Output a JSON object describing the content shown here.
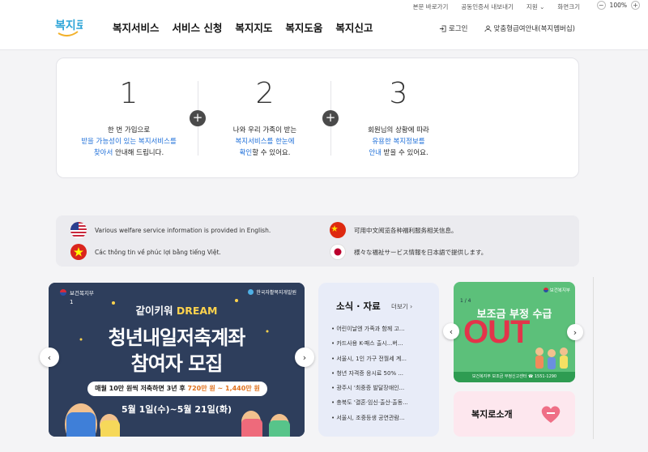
{
  "header": {
    "logo_text": "복지로",
    "utility": [
      "본문 바로가기",
      "공동인증서 내보내기",
      "지원",
      "화면크기"
    ],
    "zoom": {
      "minus": "−",
      "value": "100%",
      "plus": "+"
    },
    "nav": [
      "복지서비스",
      "서비스 신청",
      "복지지도",
      "복지도움",
      "복지신고"
    ],
    "login": "로그인",
    "mypage": "맞춤형급여안내(복지멤버십)"
  },
  "steps": [
    {
      "num": "1",
      "line1": "한 번 가입으로",
      "line2_blue": "받을 가능성이 있는 복지서비스를",
      "line3_blue": "찾아서",
      "line3_rest": " 안내해 드립니다."
    },
    {
      "num": "2",
      "line1": "나와 우리 가족이 받는",
      "line2_blue": "복지서비스를 한눈에",
      "line3_blue": "확인",
      "line3_rest": "할 수 있어요."
    },
    {
      "num": "3",
      "line1": "회원님의 상황에 따라",
      "line2_blue": "유용한 복지정보를",
      "line3_blue": "안내",
      "line3_rest": " 받을 수 있어요."
    }
  ],
  "plus_symbol": "+",
  "languages": [
    {
      "flag": "us-flag-icon",
      "text": "Various welfare service information is provided in English."
    },
    {
      "flag": "china-flag-icon",
      "text": "可用中文阅览各种福利服务相关信息。"
    },
    {
      "flag": "vietnam-flag-icon",
      "text": "Các thông tin về phúc lợi bằng tiếng Việt."
    },
    {
      "flag": "japan-flag-icon",
      "text": "様々な福祉サービス情報を日本語で提供します。"
    }
  ],
  "banner": {
    "ministry": "보건복지부",
    "institute": "한국자활복지개발원",
    "counter": "1",
    "together_prefix": "같이키워 ",
    "together_highlight": "DREAM",
    "title1": "청년내일저축계좌",
    "title2": "참여자 모집",
    "pill_a": "매월 10만 원씩 저축하면 3년 후 ",
    "pill_b": "720만 원 ~ 1,440만 원",
    "date": "5월 1일(수)~5월 21일(화)",
    "prev": "‹",
    "next": "›"
  },
  "news": {
    "title": "소식 · 자료",
    "more": "더보기 ›",
    "items": [
      "어린이날엔 가족과 함께 고...",
      "카드사용 K-패스 출시...버...",
      "서울시, 1인 가구 전월세 계...",
      "청년 자격증 응시료 50% ...",
      "광주시 '최중증 발달장애인...",
      "충북도 '결혼·임신·출산·출동...",
      "서울시, 조중등생 공연관람..."
    ]
  },
  "promo": {
    "ministry": "보건복지부",
    "counter": "1 / 4",
    "title": "보조금 부정 수급",
    "big": "OUT",
    "footer": "보건복지부 보조금 부정신고센터 ☎ 1551-1290",
    "prev": "‹",
    "next": "›"
  },
  "intro": {
    "label": "복지로소개"
  }
}
